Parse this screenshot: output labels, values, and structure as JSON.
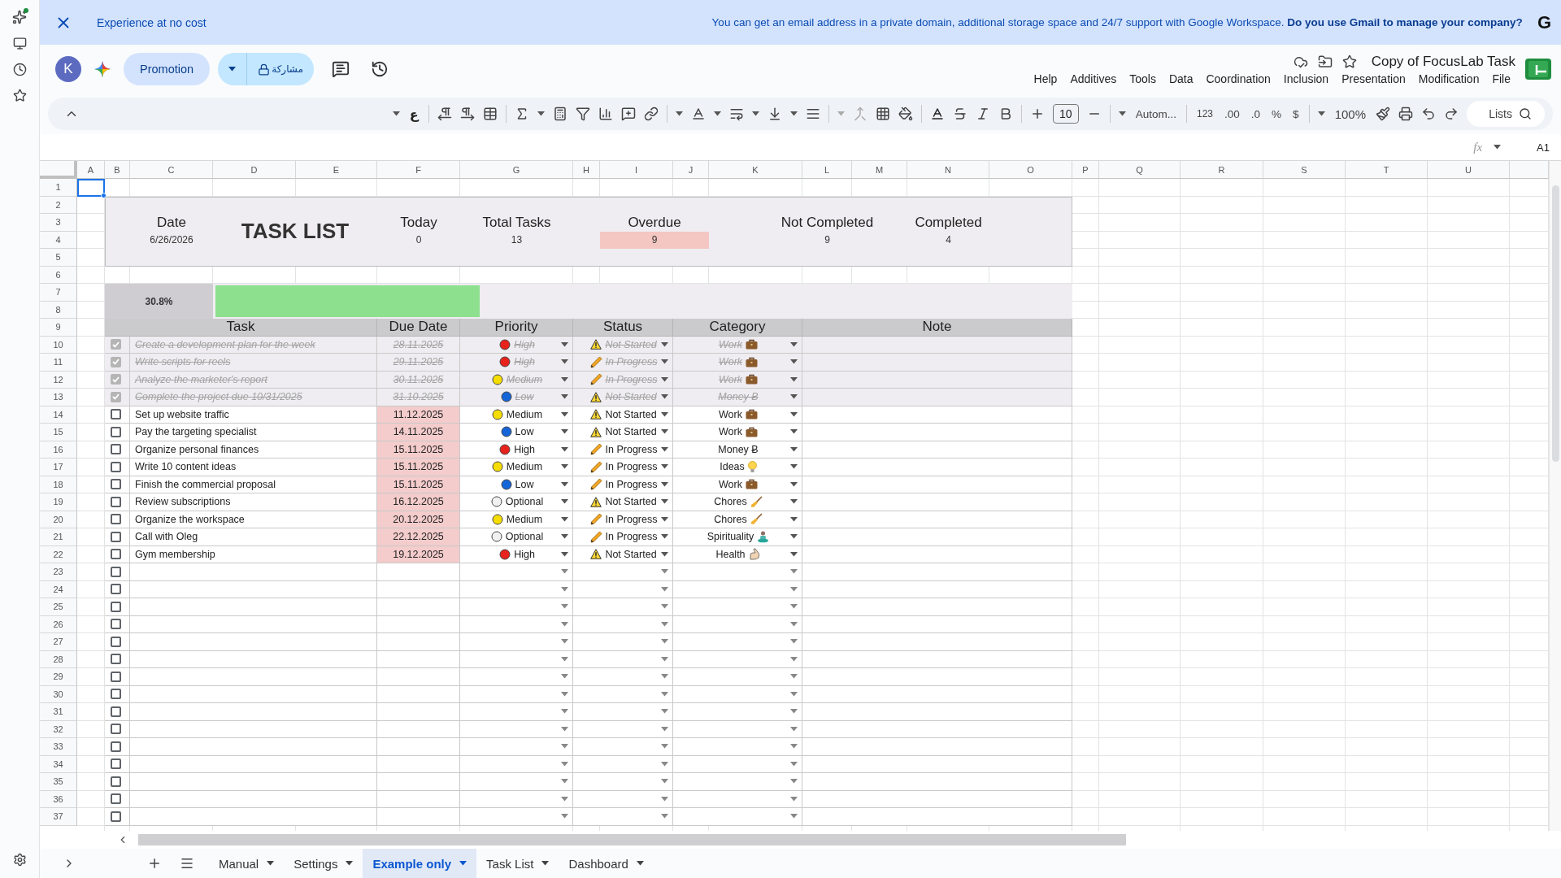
{
  "banner": {
    "title": "Experience at no cost",
    "message": "You can get an email address in a private domain, additional storage space and 24/7 support with Google Workspace. **Do you use Gmail to manage your company?**",
    "logo": "G"
  },
  "header": {
    "avatar": "K",
    "promotion": "Promotion",
    "share": "مشاركة",
    "doc_title": "Copy of FocusLab Task",
    "menu": [
      "Help",
      "Additives",
      "Tools",
      "Data",
      "Coordination",
      "Inclusion",
      "Presentation",
      "Modification",
      "File"
    ]
  },
  "toolbar": {
    "font_glyph": "ع",
    "font_size": "10",
    "format": "Autom...",
    "number_format": "123",
    "decimal_more": ".00",
    "decimal_less": ".0",
    "percent": "%",
    "currency": "$",
    "zoom": "100%",
    "search_placeholder": "Lists"
  },
  "formula_bar": {
    "fx": "fx",
    "cell": "A1"
  },
  "columns": [
    "A",
    "B",
    "C",
    "D",
    "E",
    "F",
    "G",
    "H",
    "I",
    "J",
    "K",
    "L",
    "M",
    "N",
    "O",
    "P",
    "Q",
    "R",
    "S",
    "T",
    "U"
  ],
  "row_numbers": [
    "1",
    "2",
    "3",
    "4",
    "5",
    "6",
    "7",
    "8",
    "9",
    "10",
    "11",
    "12",
    "13",
    "14",
    "15",
    "16",
    "17",
    "18",
    "19",
    "20",
    "21",
    "22",
    "23",
    "24",
    "25",
    "26",
    "27",
    "28",
    "29",
    "30",
    "31",
    "32",
    "33",
    "34",
    "35",
    "36",
    "37"
  ],
  "summary": {
    "date_label": "Date",
    "date": "6/26/2026",
    "title": "TASK LIST",
    "stats": [
      {
        "label": "Today",
        "value": "0",
        "highlight": false
      },
      {
        "label": "Total Tasks",
        "value": "13",
        "highlight": false
      },
      {
        "label": "Overdue",
        "value": "9",
        "highlight": true
      },
      {
        "label": "Not Completed",
        "value": "9",
        "highlight": false
      },
      {
        "label": "Completed",
        "value": "4",
        "highlight": false
      }
    ]
  },
  "progress": {
    "label": "30.8%",
    "level": 0.308
  },
  "table": {
    "columns": [
      "Task",
      "Due Date",
      "Priority",
      "Status",
      "Category",
      "Note"
    ],
    "rows": [
      {
        "checked": true,
        "task": "Create a development plan for the week",
        "due": "28.11.2025",
        "overdue": false,
        "priority": "High",
        "color": "#e8231c",
        "status": {
          "label": "Not Started",
          "kind": "warning"
        },
        "category": {
          "label": "Work",
          "kind": "briefcase"
        }
      },
      {
        "checked": true,
        "task": "Write scripts for reels",
        "due": "29.11.2025",
        "overdue": false,
        "priority": "High",
        "color": "#e8231c",
        "status": {
          "label": "In Progress",
          "kind": "pencil"
        },
        "category": {
          "label": "Work",
          "kind": "briefcase"
        }
      },
      {
        "checked": true,
        "task": "Analyze the marketer's report",
        "due": "30.11.2025",
        "overdue": false,
        "priority": "Medium",
        "color": "#f5dd00",
        "status": {
          "label": "In Progress",
          "kind": "pencil"
        },
        "category": {
          "label": "Work",
          "kind": "briefcase"
        }
      },
      {
        "checked": true,
        "task": "Complete the project due 10/31/2025",
        "due": "31.10.2025",
        "overdue": false,
        "priority": "Low",
        "color": "#1565d8",
        "status": {
          "label": "Not Started",
          "kind": "warning"
        },
        "category": {
          "label": "Money Ƀ",
          "kind": "text"
        }
      },
      {
        "checked": false,
        "task": "Set up website traffic",
        "due": "11.12.2025",
        "overdue": true,
        "priority": "Medium",
        "color": "#f5dd00",
        "status": {
          "label": "Not Started",
          "kind": "warning"
        },
        "category": {
          "label": "Work",
          "kind": "briefcase"
        }
      },
      {
        "checked": false,
        "task": "Pay the targeting specialist",
        "due": "14.11.2025",
        "overdue": true,
        "priority": "Low",
        "color": "#1565d8",
        "status": {
          "label": "Not Started",
          "kind": "warning"
        },
        "category": {
          "label": "Work",
          "kind": "briefcase"
        }
      },
      {
        "checked": false,
        "task": "Organize personal finances",
        "due": "15.11.2025",
        "overdue": true,
        "priority": "High",
        "color": "#e8231c",
        "status": {
          "label": "In Progress",
          "kind": "pencil"
        },
        "category": {
          "label": "Money Ƀ",
          "kind": "text"
        }
      },
      {
        "checked": false,
        "task": "Write 10 content ideas",
        "due": "15.11.2025",
        "overdue": true,
        "priority": "Medium",
        "color": "#f5dd00",
        "status": {
          "label": "In Progress",
          "kind": "pencil"
        },
        "category": {
          "label": "Ideas",
          "kind": "bulb"
        }
      },
      {
        "checked": false,
        "task": "Finish the commercial proposal",
        "due": "15.11.2025",
        "overdue": true,
        "priority": "Low",
        "color": "#1565d8",
        "status": {
          "label": "In Progress",
          "kind": "pencil"
        },
        "category": {
          "label": "Work",
          "kind": "briefcase"
        }
      },
      {
        "checked": false,
        "task": "Review subscriptions",
        "due": "16.12.2025",
        "overdue": true,
        "priority": "Optional",
        "color": "#f1f1f1",
        "status": {
          "label": "Not Started",
          "kind": "warning"
        },
        "category": {
          "label": "Chores",
          "kind": "broom"
        }
      },
      {
        "checked": false,
        "task": "Organize the workspace",
        "due": "20.12.2025",
        "overdue": true,
        "priority": "Medium",
        "color": "#f5dd00",
        "status": {
          "label": "In Progress",
          "kind": "pencil"
        },
        "category": {
          "label": "Chores",
          "kind": "broom"
        }
      },
      {
        "checked": false,
        "task": "Call with Oleg",
        "due": "22.12.2025",
        "overdue": true,
        "priority": "Optional",
        "color": "#f1f1f1",
        "status": {
          "label": "In Progress",
          "kind": "pencil"
        },
        "category": {
          "label": "Spirituality",
          "kind": "figure"
        }
      },
      {
        "checked": false,
        "task": "Gym membership",
        "due": "19.12.2025",
        "overdue": true,
        "priority": "High",
        "color": "#e8231c",
        "status": {
          "label": "Not Started",
          "kind": "warning"
        },
        "category": {
          "label": "Health",
          "kind": "arm"
        }
      }
    ],
    "empty_rows": [
      {
        "checked": false
      },
      {
        "checked": false
      },
      {
        "checked": false
      },
      {
        "checked": false
      },
      {
        "checked": false
      },
      {
        "checked": false
      },
      {
        "checked": false
      },
      {
        "checked": false
      },
      {
        "checked": false
      },
      {
        "checked": false
      },
      {
        "checked": false
      },
      {
        "checked": false
      },
      {
        "checked": false
      },
      {
        "checked": false
      },
      {
        "checked": false
      }
    ]
  },
  "sheet_tabs": [
    {
      "label": "Manual",
      "selected": false
    },
    {
      "label": "Settings",
      "selected": false
    },
    {
      "label": "Example only",
      "selected": true
    },
    {
      "label": "Task List",
      "selected": false
    },
    {
      "label": "Dashboard",
      "selected": false
    }
  ]
}
